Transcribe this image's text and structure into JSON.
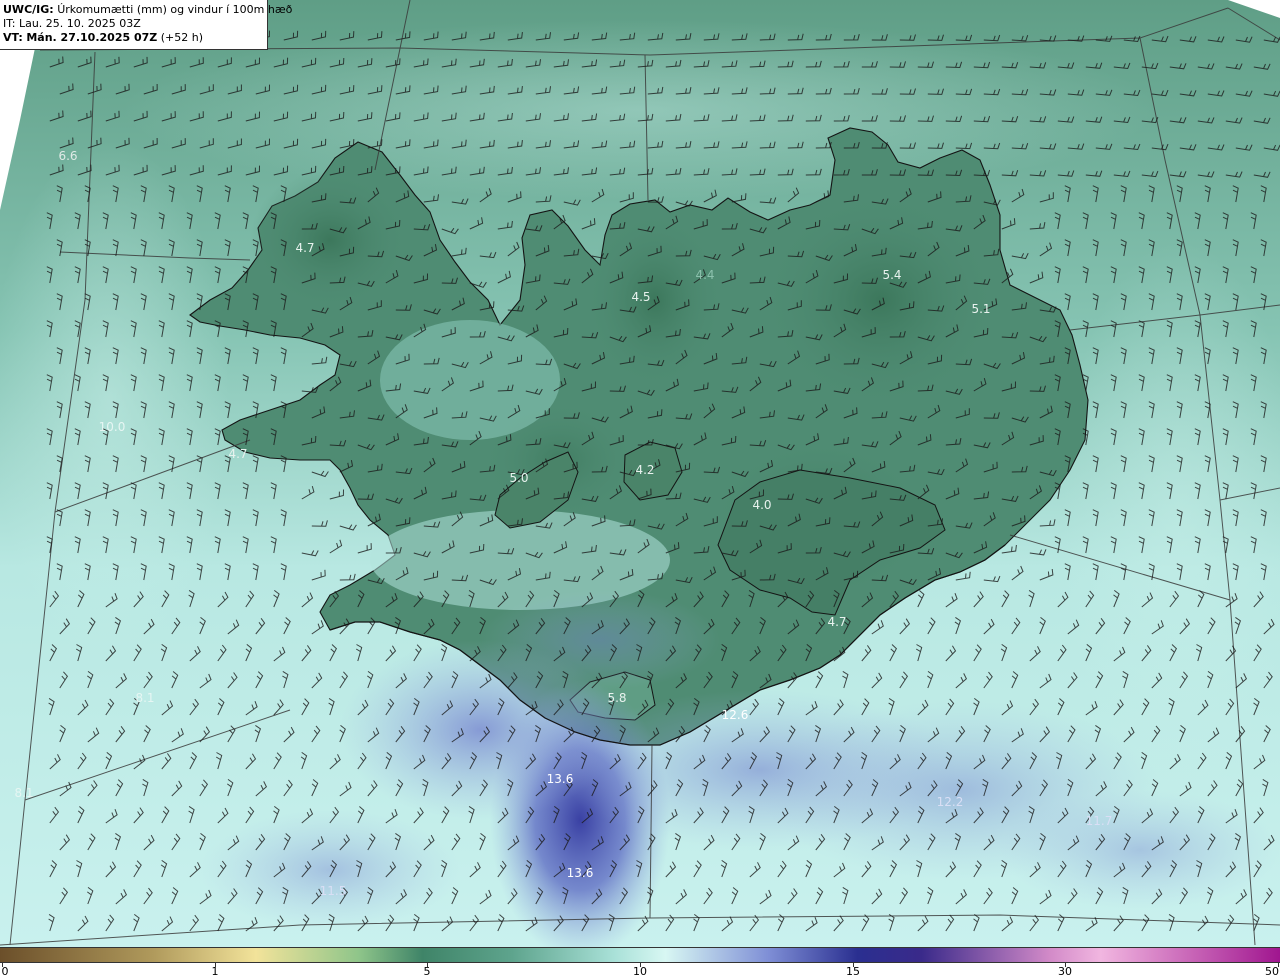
{
  "header": {
    "product": "UWC/IG:",
    "description": "Úrkomumætti (mm) og vindur í 100m hæð",
    "issue_label": "IT:",
    "issue_time": "Lau. 25. 10. 2025 03Z",
    "valid_label": "VT:",
    "valid_time": "Mán. 27.10.2025 07Z",
    "lead": "(+52 h)"
  },
  "colorbar": {
    "ticks": [
      "0",
      "1",
      "5",
      "10",
      "15",
      "30",
      "50"
    ],
    "tick_values": [
      0,
      1,
      5,
      10,
      15,
      30,
      50
    ],
    "tick_fractions": [
      0,
      0.1667,
      0.3333,
      0.5,
      0.6667,
      0.8333,
      1.0
    ],
    "colors": [
      "#6b4f2a",
      "#b8a86a",
      "#f2e39a",
      "#3f8468",
      "#86c7b9",
      "#bfeee9",
      "#4e5bb8",
      "#2a1f7a",
      "#e79ad0",
      "#a0168f"
    ]
  },
  "map_labels": [
    {
      "text": "6.6"
    },
    {
      "text": "4.7"
    },
    {
      "text": "4.4"
    },
    {
      "text": "4.5"
    },
    {
      "text": "5.4"
    },
    {
      "text": "5.1"
    },
    {
      "text": "10.0"
    },
    {
      "text": "4.7"
    },
    {
      "text": "5.0"
    },
    {
      "text": "4.2"
    },
    {
      "text": "4.0"
    },
    {
      "text": "4.7"
    },
    {
      "text": "8.1"
    },
    {
      "text": "5.8"
    },
    {
      "text": "12.6"
    },
    {
      "text": "13.6"
    },
    {
      "text": "8.1"
    },
    {
      "text": "12.2"
    },
    {
      "text": "11.7"
    },
    {
      "text": "13.6"
    },
    {
      "text": "11.5"
    }
  ],
  "colors": {
    "land_dark": "#3e7a5f",
    "land_mid": "#5e9c84",
    "sea_light": "#a9ddd6",
    "sea_blue": "#6f7dcc",
    "sea_deep": "#3a3fa5",
    "coast": "#1a1a1a"
  }
}
